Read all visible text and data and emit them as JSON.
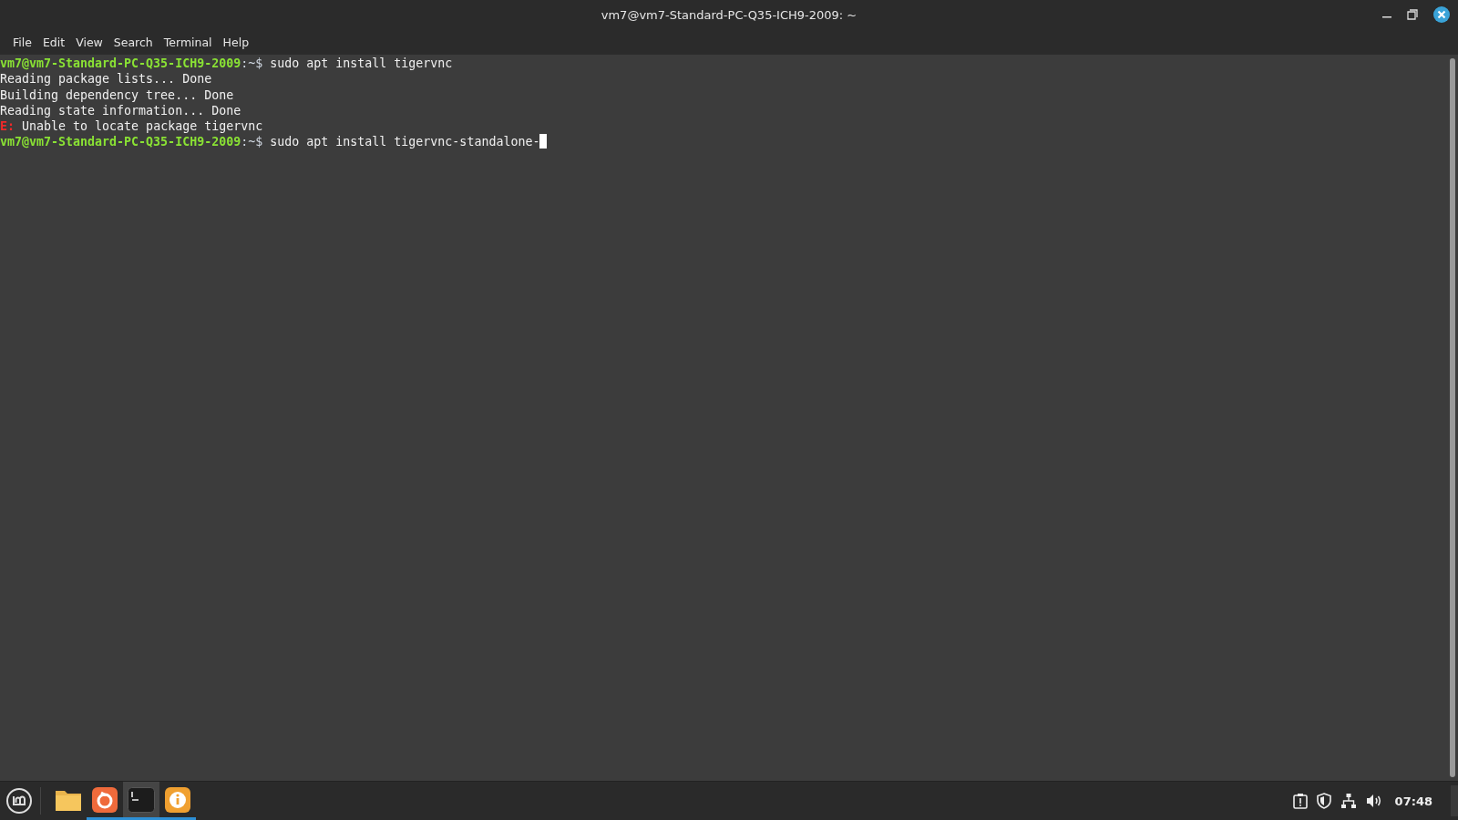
{
  "window": {
    "title": "vm7@vm7-Standard-PC-Q35-ICH9-2009: ~"
  },
  "menu": [
    "File",
    "Edit",
    "View",
    "Search",
    "Terminal",
    "Help"
  ],
  "terminal": {
    "lines": [
      {
        "kind": "prompt",
        "user": "vm7@vm7-Standard-PC-Q35-ICH9-2009",
        "path": ":~$",
        "command": "sudo apt install tigervnc",
        "cursor": false
      },
      {
        "kind": "output",
        "text": "Reading package lists... Done"
      },
      {
        "kind": "output",
        "text": "Building dependency tree... Done"
      },
      {
        "kind": "output",
        "text": "Reading state information... Done"
      },
      {
        "kind": "error",
        "label": "E:",
        "text": "Unable to locate package tigervnc"
      },
      {
        "kind": "prompt",
        "user": "vm7@vm7-Standard-PC-Q35-ICH9-2009",
        "path": ":~$",
        "command": "sudo apt install tigervnc-standalone-",
        "cursor": true
      }
    ]
  },
  "taskbar": {
    "apps": [
      {
        "kind": "files",
        "running": false,
        "selected": false
      },
      {
        "kind": "firefox",
        "running": true,
        "selected": false
      },
      {
        "kind": "terminal",
        "running": true,
        "selected": true
      },
      {
        "kind": "info",
        "running": true,
        "selected": false
      }
    ],
    "clock": "07:48"
  }
}
